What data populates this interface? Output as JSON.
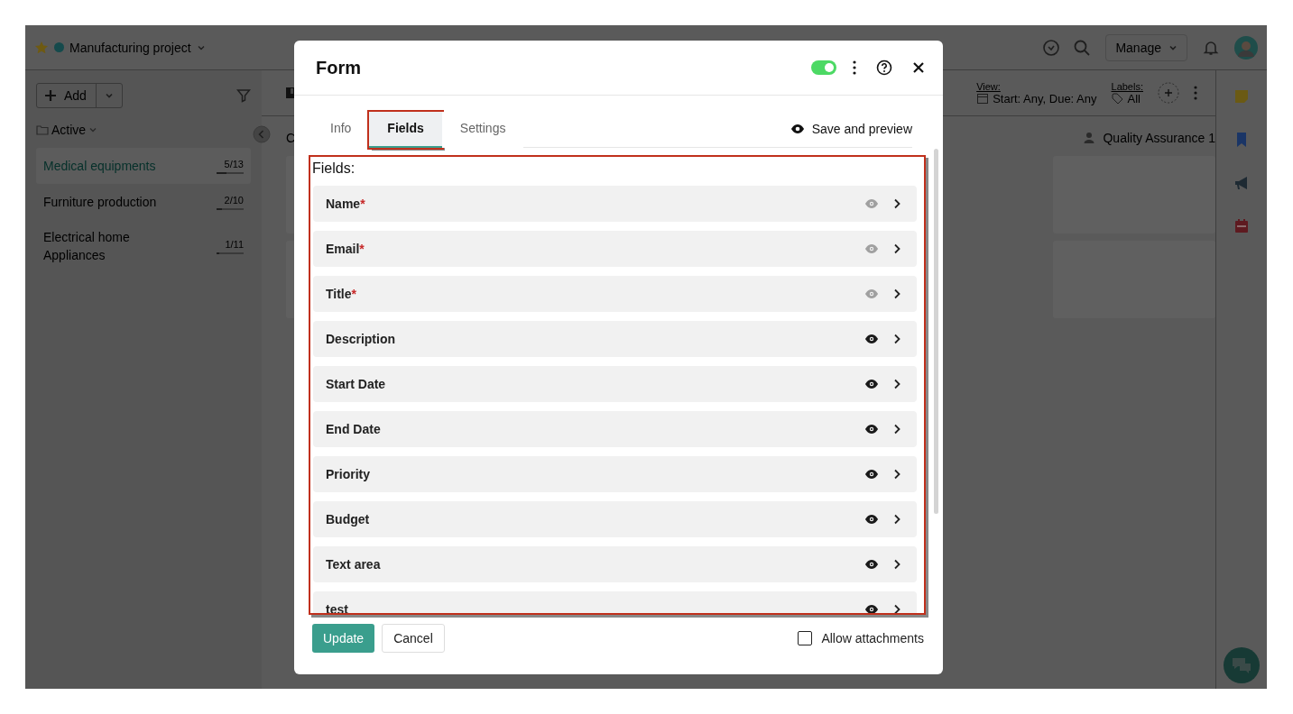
{
  "topbar": {
    "project": "Manufacturing project",
    "manage": "Manage"
  },
  "sidebar": {
    "add": "Add",
    "group": "Active",
    "projects": [
      {
        "name": "Medical equipments",
        "count": "5/13",
        "level": 0.38,
        "selected": true
      },
      {
        "name": "Furniture production",
        "count": "2/10",
        "level": 0.2,
        "selected": false
      },
      {
        "name": "Electrical home Appliances",
        "count": "1/11",
        "level": 0.09,
        "selected": false
      }
    ]
  },
  "toolbar": {
    "view_label": "View:",
    "view_value": "Start: Any, Due: Any",
    "labels_label": "Labels:",
    "labels_value": "All"
  },
  "board": {
    "columns": [
      {
        "title": "C"
      },
      {
        "title": "Quality Assurance 1"
      }
    ]
  },
  "modal": {
    "title": "Form",
    "enabled": true,
    "tabs": [
      {
        "label": "Info",
        "selected": false
      },
      {
        "label": "Fields",
        "selected": true
      },
      {
        "label": "Settings",
        "selected": false
      }
    ],
    "save_preview": "Save and preview",
    "fields_heading": "Fields:",
    "fields": [
      {
        "name": "Name",
        "required_mark": "*",
        "visible": false
      },
      {
        "name": "Email",
        "required_mark": "*",
        "visible": false
      },
      {
        "name": "Title",
        "required_mark": "*",
        "visible": false
      },
      {
        "name": "Description",
        "visible": true
      },
      {
        "name": "Start Date",
        "visible": true
      },
      {
        "name": "End Date",
        "visible": true
      },
      {
        "name": "Priority",
        "visible": true
      },
      {
        "name": "Budget",
        "visible": true
      },
      {
        "name": "Text area",
        "visible": true
      },
      {
        "name": "test",
        "visible": true
      }
    ],
    "update": "Update",
    "cancel": "Cancel",
    "allow_attachments": {
      "label": "Allow attachments",
      "checked": false
    }
  }
}
